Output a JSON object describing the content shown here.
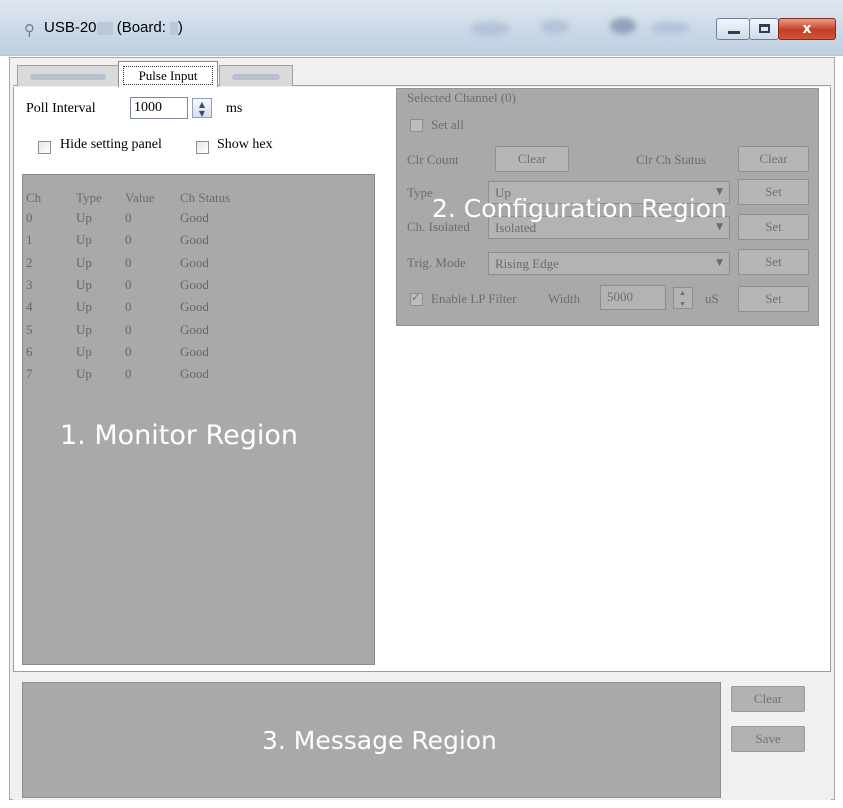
{
  "window": {
    "app_icon": "usb-icon",
    "title_prefix": "USB-20",
    "title_board": "(Board:",
    "title_suffix": ")",
    "close_glyph": "x"
  },
  "tabs": [
    {
      "label": "Information",
      "selected": false
    },
    {
      "label": "Pulse Input",
      "selected": true
    },
    {
      "label": "Data Log",
      "selected": false
    }
  ],
  "settings": {
    "poll_interval_label": "Poll Interval",
    "poll_interval_value": "1000",
    "poll_interval_unit": "ms",
    "hide_setting_panel_label": "Hide setting panel",
    "hide_setting_panel_checked": false,
    "show_hex_label": "Show hex",
    "show_hex_checked": false
  },
  "monitor": {
    "overlay_label": "1. Monitor Region",
    "columns": [
      "Ch",
      "Type",
      "Value",
      "Ch Status"
    ],
    "rows": [
      [
        "0",
        "Up",
        "0",
        "Good"
      ],
      [
        "1",
        "Up",
        "0",
        "Good"
      ],
      [
        "2",
        "Up",
        "0",
        "Good"
      ],
      [
        "3",
        "Up",
        "0",
        "Good"
      ],
      [
        "4",
        "Up",
        "0",
        "Good"
      ],
      [
        "5",
        "Up",
        "0",
        "Good"
      ],
      [
        "6",
        "Up",
        "0",
        "Good"
      ],
      [
        "7",
        "Up",
        "0",
        "Good"
      ]
    ]
  },
  "config": {
    "overlay_label": "2. Configuration Region",
    "selected_channel": "Selected Channel (0)",
    "set_all_label": "Set all",
    "clr_count_label": "Clr Count",
    "clr_count_button": "Clear",
    "clr_status_label": "Clr Ch Status",
    "clr_status_button": "Clear",
    "type_label": "Type",
    "type_value": "Up",
    "ch_isolated_label": "Ch. Isolated",
    "ch_isolated_value": "Isolated",
    "trig_mode_label": "Trig. Mode",
    "trig_mode_value": "Rising Edge",
    "set_button": "Set",
    "lp_filter_label": "Enable LP Filter",
    "lp_filter_checked": true,
    "width_label": "Width",
    "width_value": "5000",
    "width_unit": "uS"
  },
  "message": {
    "overlay_label": "3. Message Region",
    "clear_button": "Clear",
    "save_button": "Save"
  }
}
